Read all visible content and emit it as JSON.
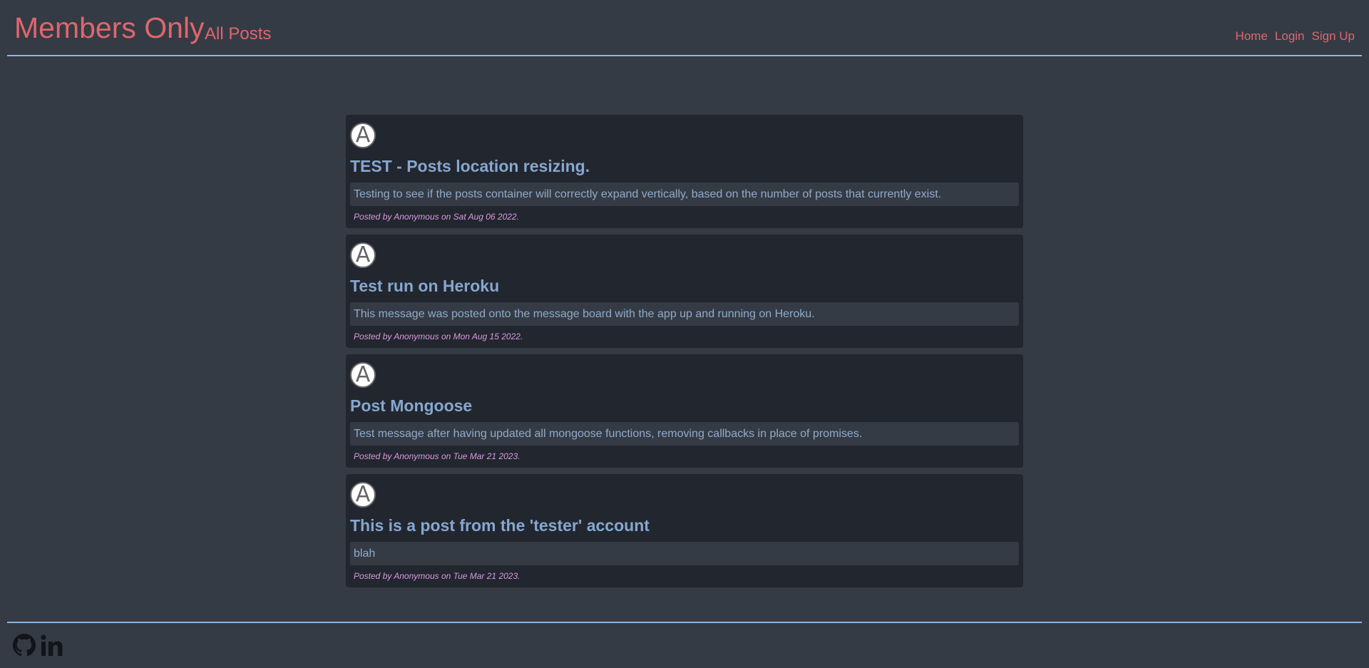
{
  "header": {
    "brand": "Members Only",
    "subtitle": "All Posts",
    "nav": [
      "Home",
      "Login",
      "Sign Up"
    ]
  },
  "posts": [
    {
      "avatar_letter": "A",
      "title": "TEST - Posts location resizing.",
      "body": "Testing to see if the posts container will correctly expand vertically, based on the number of posts that currently exist.",
      "meta": "Posted by Anonymous on Sat Aug 06 2022."
    },
    {
      "avatar_letter": "A",
      "title": "Test run on Heroku",
      "body": "This message was posted onto the message board with the app up and running on Heroku.",
      "meta": "Posted by Anonymous on Mon Aug 15 2022."
    },
    {
      "avatar_letter": "A",
      "title": "Post Mongoose",
      "body": "Test message after having updated all mongoose functions, removing callbacks in place of promises.",
      "meta": "Posted by Anonymous on Tue Mar 21 2023."
    },
    {
      "avatar_letter": "A",
      "title": "This is a post from the 'tester' account",
      "body": "blah",
      "meta": "Posted by Anonymous on Tue Mar 21 2023."
    }
  ],
  "footer": {
    "icons": [
      "github-icon",
      "linkedin-icon"
    ]
  },
  "colors": {
    "background": "#343b45",
    "card": "#22262e",
    "accent": "#e0666c",
    "title": "#86a7d0",
    "meta": "#d89be0",
    "divider": "#8fb3de"
  }
}
